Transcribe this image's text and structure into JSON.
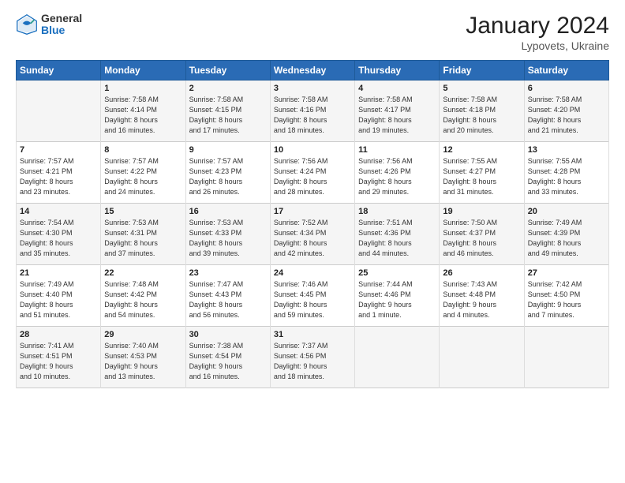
{
  "header": {
    "logo_general": "General",
    "logo_blue": "Blue",
    "title": "January 2024",
    "subtitle": "Lypovets, Ukraine"
  },
  "days_header": [
    "Sunday",
    "Monday",
    "Tuesday",
    "Wednesday",
    "Thursday",
    "Friday",
    "Saturday"
  ],
  "weeks": [
    [
      {
        "day": "",
        "lines": []
      },
      {
        "day": "1",
        "lines": [
          "Sunrise: 7:58 AM",
          "Sunset: 4:14 PM",
          "Daylight: 8 hours",
          "and 16 minutes."
        ]
      },
      {
        "day": "2",
        "lines": [
          "Sunrise: 7:58 AM",
          "Sunset: 4:15 PM",
          "Daylight: 8 hours",
          "and 17 minutes."
        ]
      },
      {
        "day": "3",
        "lines": [
          "Sunrise: 7:58 AM",
          "Sunset: 4:16 PM",
          "Daylight: 8 hours",
          "and 18 minutes."
        ]
      },
      {
        "day": "4",
        "lines": [
          "Sunrise: 7:58 AM",
          "Sunset: 4:17 PM",
          "Daylight: 8 hours",
          "and 19 minutes."
        ]
      },
      {
        "day": "5",
        "lines": [
          "Sunrise: 7:58 AM",
          "Sunset: 4:18 PM",
          "Daylight: 8 hours",
          "and 20 minutes."
        ]
      },
      {
        "day": "6",
        "lines": [
          "Sunrise: 7:58 AM",
          "Sunset: 4:20 PM",
          "Daylight: 8 hours",
          "and 21 minutes."
        ]
      }
    ],
    [
      {
        "day": "7",
        "lines": [
          "Sunrise: 7:57 AM",
          "Sunset: 4:21 PM",
          "Daylight: 8 hours",
          "and 23 minutes."
        ]
      },
      {
        "day": "8",
        "lines": [
          "Sunrise: 7:57 AM",
          "Sunset: 4:22 PM",
          "Daylight: 8 hours",
          "and 24 minutes."
        ]
      },
      {
        "day": "9",
        "lines": [
          "Sunrise: 7:57 AM",
          "Sunset: 4:23 PM",
          "Daylight: 8 hours",
          "and 26 minutes."
        ]
      },
      {
        "day": "10",
        "lines": [
          "Sunrise: 7:56 AM",
          "Sunset: 4:24 PM",
          "Daylight: 8 hours",
          "and 28 minutes."
        ]
      },
      {
        "day": "11",
        "lines": [
          "Sunrise: 7:56 AM",
          "Sunset: 4:26 PM",
          "Daylight: 8 hours",
          "and 29 minutes."
        ]
      },
      {
        "day": "12",
        "lines": [
          "Sunrise: 7:55 AM",
          "Sunset: 4:27 PM",
          "Daylight: 8 hours",
          "and 31 minutes."
        ]
      },
      {
        "day": "13",
        "lines": [
          "Sunrise: 7:55 AM",
          "Sunset: 4:28 PM",
          "Daylight: 8 hours",
          "and 33 minutes."
        ]
      }
    ],
    [
      {
        "day": "14",
        "lines": [
          "Sunrise: 7:54 AM",
          "Sunset: 4:30 PM",
          "Daylight: 8 hours",
          "and 35 minutes."
        ]
      },
      {
        "day": "15",
        "lines": [
          "Sunrise: 7:53 AM",
          "Sunset: 4:31 PM",
          "Daylight: 8 hours",
          "and 37 minutes."
        ]
      },
      {
        "day": "16",
        "lines": [
          "Sunrise: 7:53 AM",
          "Sunset: 4:33 PM",
          "Daylight: 8 hours",
          "and 39 minutes."
        ]
      },
      {
        "day": "17",
        "lines": [
          "Sunrise: 7:52 AM",
          "Sunset: 4:34 PM",
          "Daylight: 8 hours",
          "and 42 minutes."
        ]
      },
      {
        "day": "18",
        "lines": [
          "Sunrise: 7:51 AM",
          "Sunset: 4:36 PM",
          "Daylight: 8 hours",
          "and 44 minutes."
        ]
      },
      {
        "day": "19",
        "lines": [
          "Sunrise: 7:50 AM",
          "Sunset: 4:37 PM",
          "Daylight: 8 hours",
          "and 46 minutes."
        ]
      },
      {
        "day": "20",
        "lines": [
          "Sunrise: 7:49 AM",
          "Sunset: 4:39 PM",
          "Daylight: 8 hours",
          "and 49 minutes."
        ]
      }
    ],
    [
      {
        "day": "21",
        "lines": [
          "Sunrise: 7:49 AM",
          "Sunset: 4:40 PM",
          "Daylight: 8 hours",
          "and 51 minutes."
        ]
      },
      {
        "day": "22",
        "lines": [
          "Sunrise: 7:48 AM",
          "Sunset: 4:42 PM",
          "Daylight: 8 hours",
          "and 54 minutes."
        ]
      },
      {
        "day": "23",
        "lines": [
          "Sunrise: 7:47 AM",
          "Sunset: 4:43 PM",
          "Daylight: 8 hours",
          "and 56 minutes."
        ]
      },
      {
        "day": "24",
        "lines": [
          "Sunrise: 7:46 AM",
          "Sunset: 4:45 PM",
          "Daylight: 8 hours",
          "and 59 minutes."
        ]
      },
      {
        "day": "25",
        "lines": [
          "Sunrise: 7:44 AM",
          "Sunset: 4:46 PM",
          "Daylight: 9 hours",
          "and 1 minute."
        ]
      },
      {
        "day": "26",
        "lines": [
          "Sunrise: 7:43 AM",
          "Sunset: 4:48 PM",
          "Daylight: 9 hours",
          "and 4 minutes."
        ]
      },
      {
        "day": "27",
        "lines": [
          "Sunrise: 7:42 AM",
          "Sunset: 4:50 PM",
          "Daylight: 9 hours",
          "and 7 minutes."
        ]
      }
    ],
    [
      {
        "day": "28",
        "lines": [
          "Sunrise: 7:41 AM",
          "Sunset: 4:51 PM",
          "Daylight: 9 hours",
          "and 10 minutes."
        ]
      },
      {
        "day": "29",
        "lines": [
          "Sunrise: 7:40 AM",
          "Sunset: 4:53 PM",
          "Daylight: 9 hours",
          "and 13 minutes."
        ]
      },
      {
        "day": "30",
        "lines": [
          "Sunrise: 7:38 AM",
          "Sunset: 4:54 PM",
          "Daylight: 9 hours",
          "and 16 minutes."
        ]
      },
      {
        "day": "31",
        "lines": [
          "Sunrise: 7:37 AM",
          "Sunset: 4:56 PM",
          "Daylight: 9 hours",
          "and 18 minutes."
        ]
      },
      {
        "day": "",
        "lines": []
      },
      {
        "day": "",
        "lines": []
      },
      {
        "day": "",
        "lines": []
      }
    ]
  ]
}
